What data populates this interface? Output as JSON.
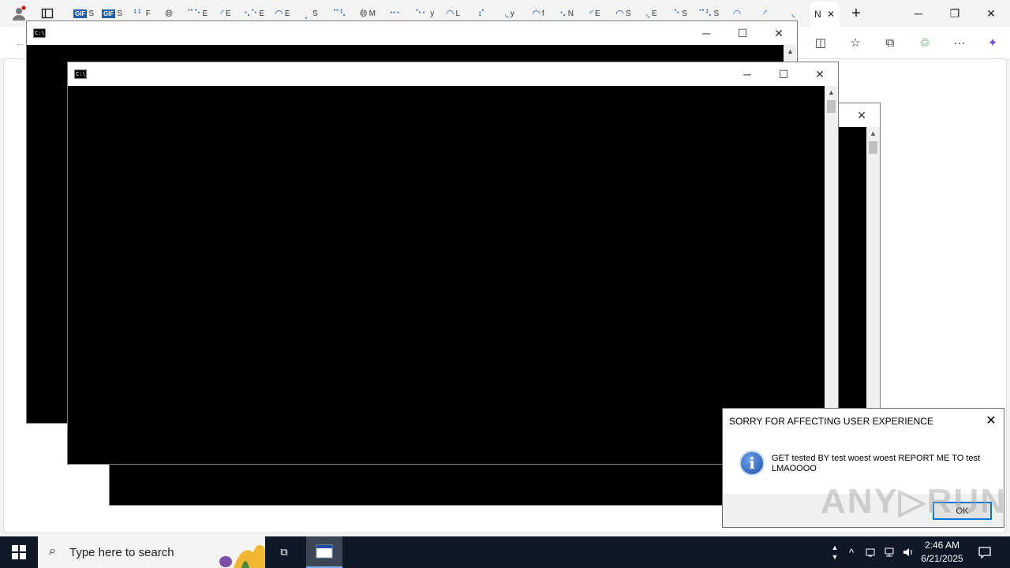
{
  "browser": {
    "tabs": [
      "S",
      "S",
      "F",
      "E",
      "E",
      "E",
      "E",
      "S",
      "M",
      "y",
      "L",
      "y",
      "f",
      "N",
      "E",
      "S",
      "E",
      "S",
      "S"
    ],
    "active_tab": {
      "label": "N",
      "close": "✕"
    },
    "new_tab": "+",
    "controls": {
      "minimize": "─",
      "restore": "❐",
      "close": "✕"
    },
    "toolbar": {
      "back": "←",
      "split": "◫",
      "favorites": "☆",
      "collections": "⧉",
      "extensions": "♲",
      "more": "···",
      "copilot": "✦"
    }
  },
  "console_windows": [
    {
      "title_icon": "C:\\_",
      "minimize": "─",
      "maximize": "☐",
      "close": "✕"
    },
    {
      "title_icon": "C:\\_",
      "minimize": "─",
      "maximize": "☐",
      "close": "✕"
    },
    {
      "close": "✕"
    }
  ],
  "scroll": {
    "up": "▲"
  },
  "dialog": {
    "title": "SORRY FOR AFFECTING USER EXPERIENCE",
    "message": "GET tested BY test woest woest REPORT ME TO test LMAOOOO",
    "ok": "OK",
    "close": "✕",
    "icon": "i"
  },
  "watermark": "ANY▷RUN",
  "taskbar": {
    "search_placeholder": "Type here to search",
    "search_icon": "⌕",
    "taskview_icon": "⧉",
    "tray_up": "^",
    "time": "2:46 AM",
    "date": "6/21/2025",
    "notification": "☐"
  },
  "colors": {
    "taskbar": "#101828",
    "console": "#000000",
    "accent": "#0078d7"
  }
}
